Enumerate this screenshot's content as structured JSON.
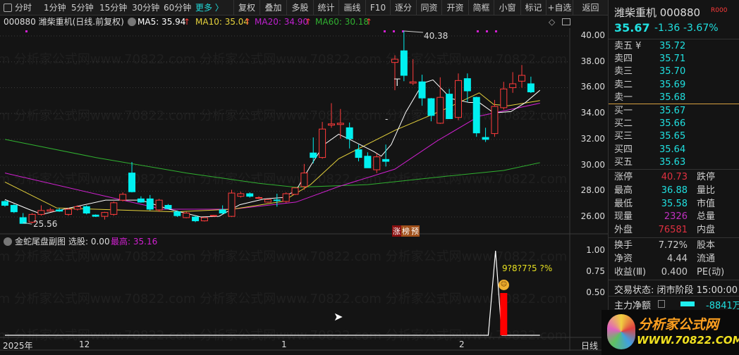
{
  "toolbar": {
    "periods": [
      "分时",
      "1分钟",
      "5分钟",
      "15分钟",
      "30分钟",
      "60分钟"
    ],
    "more": "更多 〉",
    "buttons": [
      "复权",
      "叠加",
      "多股",
      "统计",
      "画线",
      "F10",
      "逐分",
      "同资",
      "开资",
      "简框",
      "小窗",
      "标记",
      "+自选",
      "返回"
    ]
  },
  "info": {
    "title": "000880 潍柴重机(日线.前复权)",
    "ma5": "MA5: 35.94",
    "ma10": "MA10: 35.04",
    "ma20": "MA20: 34.90",
    "ma60": "MA60: 30.18",
    "up_arrow": "↑"
  },
  "sub": {
    "title": "金蛇尾盘副图",
    "xg": "选股: 0.00",
    "zg": "最高: 35.16",
    "garbled": "9?8?7?5 ?%"
  },
  "annotations": {
    "high": "40.38",
    "low": "25.56",
    "t_mark": "T",
    "dash_mark": "-",
    "badge": [
      "涨",
      "榜",
      "预"
    ]
  },
  "xaxis": {
    "labels": [
      "2025年",
      "12",
      "1",
      "2"
    ],
    "period": "日线"
  },
  "colors": {
    "up": "#ff3b3b",
    "down": "#00f0f0",
    "ma5": "#ffffff",
    "ma10": "#e6d23c",
    "ma20": "#d020d0",
    "ma60": "#30b030"
  },
  "chart_data": [
    {
      "type": "candlestick",
      "yticks": [
        "40.00",
        "38.00",
        "36.00",
        "34.00",
        "32.00",
        "30.00",
        "28.00",
        "26.00"
      ],
      "ylim": [
        25.2,
        40.6
      ],
      "candles": [
        [
          27.2,
          27.3,
          26.8,
          26.9
        ],
        [
          26.9,
          27.0,
          26.3,
          26.4
        ],
        [
          25.95,
          26.3,
          25.56,
          25.5
        ],
        [
          25.6,
          26.3,
          25.5,
          26.2
        ],
        [
          26.2,
          26.9,
          26.1,
          26.5
        ],
        [
          26.45,
          26.7,
          26.4,
          26.55
        ],
        [
          26.55,
          26.7,
          26.4,
          26.45
        ],
        [
          26.2,
          26.7,
          26.1,
          26.6
        ],
        [
          26.6,
          26.9,
          26.5,
          26.8
        ],
        [
          26.8,
          26.9,
          26.2,
          26.3
        ],
        [
          26.15,
          26.2,
          26.0,
          26.05
        ],
        [
          26.05,
          26.4,
          25.8,
          26.35
        ],
        [
          26.2,
          27.2,
          26.1,
          27.1
        ],
        [
          27.3,
          27.9,
          27.2,
          27.75
        ],
        [
          29.4,
          30.25,
          27.9,
          27.95
        ],
        [
          27.4,
          27.6,
          27.1,
          27.15
        ],
        [
          27.4,
          27.7,
          26.5,
          26.6
        ],
        [
          26.55,
          27.4,
          26.4,
          27.3
        ],
        [
          26.9,
          27.0,
          26.6,
          26.65
        ],
        [
          26.4,
          26.5,
          26.0,
          26.1
        ],
        [
          25.95,
          26.4,
          25.9,
          26.3
        ],
        [
          26.0,
          26.1,
          25.6,
          25.7
        ],
        [
          25.7,
          26.0,
          25.65,
          25.95
        ],
        [
          26.08,
          26.15,
          26.05,
          26.12
        ],
        [
          26.55,
          26.9,
          26.2,
          26.3
        ],
        [
          26.05,
          28.1,
          26.0,
          27.85
        ],
        [
          27.6,
          27.95,
          27.5,
          27.8
        ],
        [
          27.8,
          27.9,
          27.5,
          27.6
        ],
        [
          27.45,
          27.6,
          27.4,
          27.5
        ],
        [
          27.15,
          27.4,
          27.1,
          27.35
        ],
        [
          27.32,
          27.8,
          26.8,
          27.28
        ],
        [
          27.2,
          27.9,
          27.1,
          27.8
        ],
        [
          27.75,
          28.3,
          27.7,
          28.25
        ],
        [
          28.35,
          30.1,
          28.1,
          29.4
        ],
        [
          30.95,
          32.15,
          30.15,
          30.6
        ],
        [
          30.6,
          33.35,
          30.5,
          32.8
        ],
        [
          33.1,
          34.8,
          32.9,
          33.2
        ],
        [
          33.15,
          34.35,
          32.05,
          33.25
        ],
        [
          32.9,
          33.3,
          31.3,
          32.05
        ],
        [
          31.2,
          31.6,
          30.3,
          30.6
        ],
        [
          30.7,
          31.0,
          29.8,
          29.8
        ],
        [
          29.65,
          30.9,
          29.4,
          30.65
        ],
        [
          30.45,
          31.6,
          29.9,
          30.3
        ],
        [
          37.95,
          38.5,
          35.8,
          38.2
        ],
        [
          38.85,
          40.38,
          36.5,
          36.95
        ],
        [
          36.35,
          38.2,
          36.2,
          36.45
        ],
        [
          36.45,
          37.0,
          34.6,
          35.2
        ],
        [
          35.15,
          35.2,
          33.4,
          33.85
        ],
        [
          33.25,
          36.8,
          33.2,
          35.25
        ],
        [
          35.5,
          35.9,
          33.6,
          33.6
        ],
        [
          33.7,
          37.1,
          33.5,
          36.55
        ],
        [
          36.7,
          37.1,
          34.9,
          35.75
        ],
        [
          35.25,
          35.3,
          32.2,
          32.5
        ],
        [
          32.15,
          32.9,
          31.8,
          32.0
        ],
        [
          32.45,
          35.05,
          32.2,
          34.55
        ],
        [
          34.45,
          36.45,
          34.3,
          35.9
        ],
        [
          36.0,
          37.2,
          35.6,
          36.3
        ],
        [
          36.5,
          37.75,
          36.0,
          36.95
        ],
        [
          36.3,
          36.85,
          35.58,
          35.67
        ]
      ],
      "ma5": [
        [
          0,
          27.35
        ],
        [
          2.6,
          26.6
        ],
        [
          4.1,
          26.2
        ],
        [
          6.5,
          26.6
        ],
        [
          11.1,
          27.3
        ],
        [
          15,
          27.3
        ],
        [
          18.1,
          26.6
        ],
        [
          21.6,
          26.0
        ],
        [
          23.6,
          26.05
        ],
        [
          25.9,
          26.95
        ],
        [
          28.6,
          27.4
        ],
        [
          30.6,
          27.5
        ],
        [
          32.1,
          28.05
        ],
        [
          33.7,
          29.95
        ],
        [
          35.2,
          31.6
        ],
        [
          36.8,
          32.4
        ],
        [
          38.3,
          31.9
        ],
        [
          40.7,
          31.05
        ],
        [
          41.5,
          30.7
        ],
        [
          42.6,
          31.6
        ],
        [
          44.2,
          34.1
        ],
        [
          46.1,
          36.35
        ],
        [
          47.2,
          36.6
        ],
        [
          49.2,
          35.15
        ],
        [
          51.2,
          34.85
        ],
        [
          52.3,
          34.85
        ],
        [
          53.9,
          34.05
        ],
        [
          55.8,
          34.15
        ],
        [
          57.4,
          34.85
        ],
        [
          59,
          35.8
        ]
      ],
      "ma10": [
        [
          0,
          28.7
        ],
        [
          5.7,
          26.7
        ],
        [
          18.9,
          26.4
        ],
        [
          25.1,
          26.6
        ],
        [
          30.6,
          27.2
        ],
        [
          33.7,
          28.5
        ],
        [
          36.8,
          30.5
        ],
        [
          43,
          32.7
        ],
        [
          48.4,
          34.3
        ],
        [
          52.3,
          35.6
        ],
        [
          53.9,
          34.7
        ],
        [
          55.5,
          34.6
        ],
        [
          59,
          35.0
        ]
      ],
      "ma20": [
        [
          0,
          29.4
        ],
        [
          11.1,
          27.6
        ],
        [
          17.4,
          26.6
        ],
        [
          25.1,
          26.6
        ],
        [
          32.1,
          27.15
        ],
        [
          36.8,
          28.35
        ],
        [
          43,
          29.7
        ],
        [
          47.7,
          31.9
        ],
        [
          52.3,
          33.8
        ],
        [
          59,
          34.8
        ]
      ],
      "ma60": [
        [
          0,
          32.0
        ],
        [
          10,
          30.6
        ],
        [
          20,
          29.4
        ],
        [
          28,
          28.6
        ],
        [
          32.1,
          28.3
        ],
        [
          40,
          28.5
        ],
        [
          48,
          29.1
        ],
        [
          55,
          29.6
        ],
        [
          59,
          30.2
        ]
      ],
      "sub": {
        "yticks": [
          "1.00",
          "0.75",
          "0.50"
        ],
        "ylim": [
          0,
          1.0
        ],
        "line": [
          [
            0,
            0
          ],
          [
            53.3,
            0
          ],
          [
            54.1,
            1.0
          ],
          [
            54.8,
            0
          ],
          [
            59,
            0
          ]
        ],
        "bar_index": 55,
        "bar_value": 0.5
      }
    }
  ],
  "panel": {
    "name": "潍柴重机 000880",
    "rz": "R000",
    "price": "35.67",
    "change": "-1.36",
    "pct": "-3.67%",
    "sells": [
      {
        "l": "卖五 ¥",
        "v": "35.72"
      },
      {
        "l": "卖四",
        "v": "35.71"
      },
      {
        "l": "卖三",
        "v": "35.70"
      },
      {
        "l": "卖二",
        "v": "35.69"
      },
      {
        "l": "卖一",
        "v": "35.68"
      }
    ],
    "buys": [
      {
        "l": "买一",
        "v": "35.67"
      },
      {
        "l": "买二",
        "v": "35.66"
      },
      {
        "l": "买三",
        "v": "35.65"
      },
      {
        "l": "买四",
        "v": "35.64"
      },
      {
        "l": "买五",
        "v": "35.63"
      }
    ],
    "stats": [
      {
        "l": "涨停",
        "v": "40.73",
        "l2": "跌停"
      },
      {
        "l": "最高",
        "v": "36.88",
        "l2": "量比"
      },
      {
        "l": "最低",
        "v": "35.58",
        "l2": "市值"
      },
      {
        "l": "现量",
        "v": "2326",
        "l2": "总量"
      },
      {
        "l": "外盘",
        "v": "76581",
        "l2": "内盘"
      }
    ],
    "stats2": [
      {
        "l": "换手",
        "v": "7.72%",
        "l2": "股本"
      },
      {
        "l": "净资",
        "v": "4.44",
        "l2": "流通"
      },
      {
        "l": "收益(Ⅲ)",
        "v": "0.400",
        "l2": "PE(动)"
      }
    ],
    "status": "交易状态: 闭市阶段 15:00:00",
    "main_net_label": "主力净额",
    "main_net_value": "-8841万",
    "logo_text": "分析家公式网",
    "logo_url": "WWW.70822.COM"
  }
}
